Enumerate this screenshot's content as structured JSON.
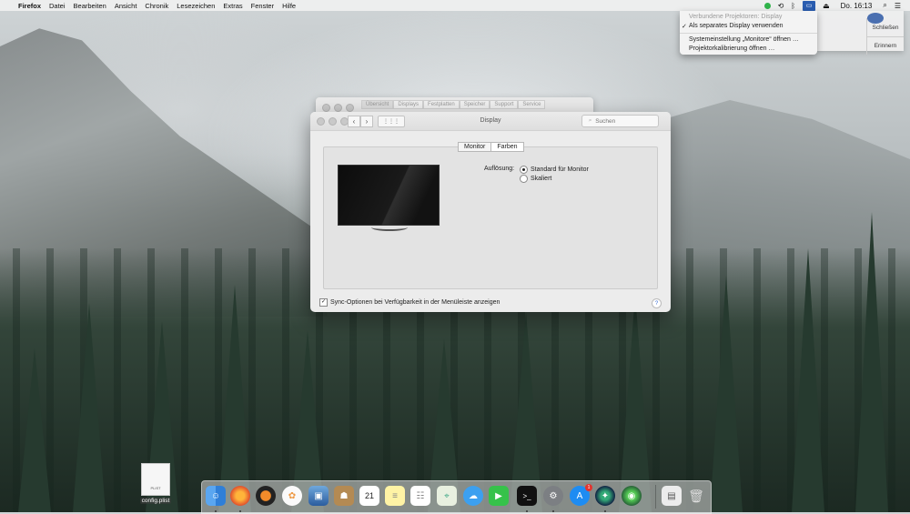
{
  "menubar": {
    "app_name": "Firefox",
    "menus": [
      "Datei",
      "Bearbeiten",
      "Ansicht",
      "Chronik",
      "Lesezeichen",
      "Extras",
      "Fenster",
      "Hilfe"
    ],
    "clock": "Do. 16:13"
  },
  "airplay_menu": {
    "header": "Verbundene Projektoren: Display",
    "checked_item": "Als separates Display verwenden",
    "item_prefs": "Systemeinstellung „Monitore“ öffnen …",
    "item_calibration": "Projektorkalibrierung öffnen …"
  },
  "notification": {
    "close_label": "Schließen",
    "remind_label": "Erinnern"
  },
  "background_window": {
    "tabs": [
      "Übersicht",
      "Displays",
      "Festplatten",
      "Speicher",
      "Support",
      "Service"
    ]
  },
  "display_window": {
    "title": "Display",
    "search_placeholder": "Suchen",
    "tabs": [
      {
        "label": "Monitor",
        "active": true
      },
      {
        "label": "Farben",
        "active": false
      }
    ],
    "resolution_label": "Auflösung:",
    "resolution_options": [
      {
        "label": "Standard für Monitor",
        "selected": true
      },
      {
        "label": "Skaliert",
        "selected": false
      }
    ],
    "sync_option": {
      "label": "Sync-Optionen bei Verfügbarkeit in der Menüleiste anzeigen",
      "checked": true
    },
    "help_label": "?"
  },
  "desktop": {
    "file_icon_text": "PLIST",
    "file_name": "config.plist"
  },
  "dock": {
    "calendar_day": "21",
    "app_store_badge": "1"
  },
  "colors": {
    "accent": "#2a5db0",
    "status_green": "#2fb34a",
    "badge_red": "#e3342f"
  }
}
